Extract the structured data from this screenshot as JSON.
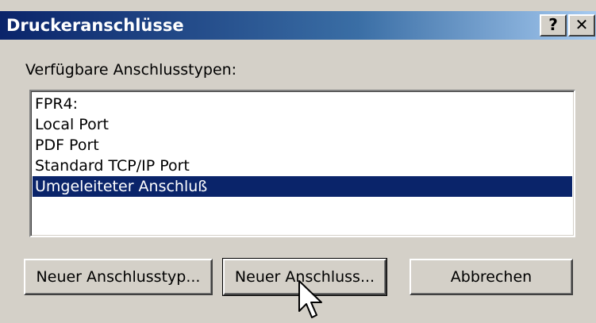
{
  "window": {
    "title": "Druckeranschlüsse",
    "help_label": "?",
    "close_label": "✕"
  },
  "label": "Verfügbare Anschlusstypen:",
  "ports": [
    "FPR4:",
    "Local Port",
    "PDF Port",
    "Standard TCP/IP Port",
    "Umgeleiteter Anschluß"
  ],
  "selected_port": "Umgeleiteter Anschluß",
  "buttons": {
    "new_port_type": "Neuer Anschlusstyp...",
    "new_port": "Neuer Anschluss...",
    "cancel": "Abbrechen"
  }
}
